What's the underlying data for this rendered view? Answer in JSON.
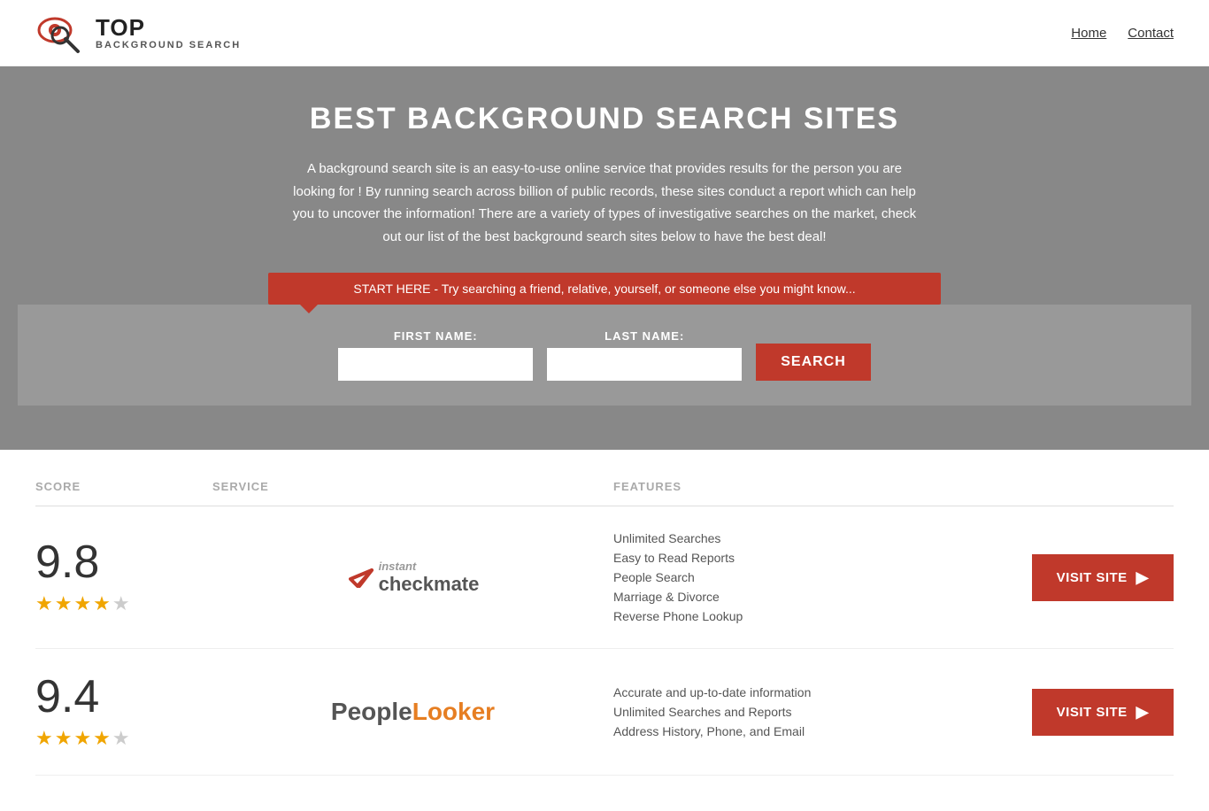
{
  "header": {
    "logo_top": "TOP",
    "logo_bottom": "BACKGROUND SEARCH",
    "nav": {
      "home": "Home",
      "contact": "Contact"
    }
  },
  "hero": {
    "title": "BEST BACKGROUND SEARCH SITES",
    "description": "A background search site is an easy-to-use online service that provides results  for the person you are looking for ! By  running  search across billion of public records, these sites conduct  a report which can help you to uncover the information! There are a variety of types of investigative searches on the market, check out our  list of the best background search sites below to have the best deal!",
    "banner_text": "START HERE - Try searching a friend, relative, yourself, or someone else you might know...",
    "form": {
      "first_name_label": "FIRST NAME:",
      "last_name_label": "LAST NAME:",
      "search_button": "SEARCH"
    }
  },
  "table": {
    "headers": {
      "score": "SCORE",
      "service": "SERVICE",
      "features": "FEATURES",
      "action": ""
    },
    "rows": [
      {
        "score": "9.8",
        "stars": "★★★★★",
        "service_name": "Instant Checkmate",
        "features": [
          "Unlimited Searches",
          "Easy to Read Reports",
          "People Search",
          "Marriage & Divorce",
          "Reverse Phone Lookup"
        ],
        "visit_label": "VISIT SITE"
      },
      {
        "score": "9.4",
        "stars": "★★★★★",
        "service_name": "PeopleLooker",
        "features": [
          "Accurate and up-to-date information",
          "Unlimited Searches and Reports",
          "Address History, Phone, and Email"
        ],
        "visit_label": "VISIT SITE"
      }
    ]
  }
}
